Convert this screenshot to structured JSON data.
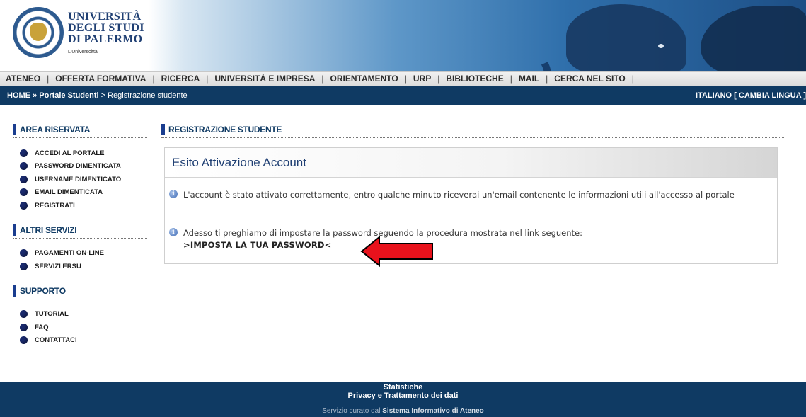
{
  "header": {
    "logo_lines": [
      "UNIVERSITÀ",
      "DEGLI STUDI",
      "DI PALERMO"
    ],
    "logo_tagline": "L'Universcittà"
  },
  "nav": {
    "items": [
      "ATENEO",
      "OFFERTA FORMATIVA",
      "RICERCA",
      "UNIVERSITÀ E IMPRESA",
      "ORIENTAMENTO",
      "URP",
      "BIBLIOTECHE",
      "MAIL",
      "CERCA NEL SITO"
    ],
    "separator": "|"
  },
  "breadcrumb": {
    "home": "HOME",
    "sep1": " » ",
    "portal": "Portale Studenti",
    "sep2": " > ",
    "current": "Registrazione studente",
    "language": "ITALIANO [ CAMBIA LINGUA ]"
  },
  "sidebar": {
    "sections": [
      {
        "title": "AREA RISERVATA",
        "items": [
          "ACCEDI AL PORTALE",
          "PASSWORD DIMENTICATA",
          "USERNAME DIMENTICATO",
          "EMAIL DIMENTICATA",
          "REGISTRATI"
        ]
      },
      {
        "title": "ALTRI SERVIZI",
        "items": [
          "PAGAMENTI ON-LINE",
          "SERVIZI ERSU"
        ]
      },
      {
        "title": "SUPPORTO",
        "items": [
          "TUTORIAL",
          "FAQ",
          "CONTATTACI"
        ]
      }
    ]
  },
  "main": {
    "title": "REGISTRAZIONE STUDENTE",
    "panel_title": "Esito Attivazione Account",
    "message1": "L'account è stato attivato correttamente, entro qualche minuto riceverai un'email contenente le informazioni utili all'accesso al portale",
    "message2": "Adesso ti preghiamo di impostare la password seguendo la procedura mostrata nel link seguente:",
    "link": ">IMPOSTA LA TUA PASSWORD<"
  },
  "colors": {
    "navy": "#0f3a63",
    "arrow_red": "#e8121c",
    "bullet": "#1a2a6e"
  },
  "footer": {
    "line1": "Statistiche",
    "line2": "Privacy e Trattamento dei dati",
    "line3_prefix": "Servizio curato dal ",
    "line3_strong": "Sistema Informativo di Ateneo"
  }
}
